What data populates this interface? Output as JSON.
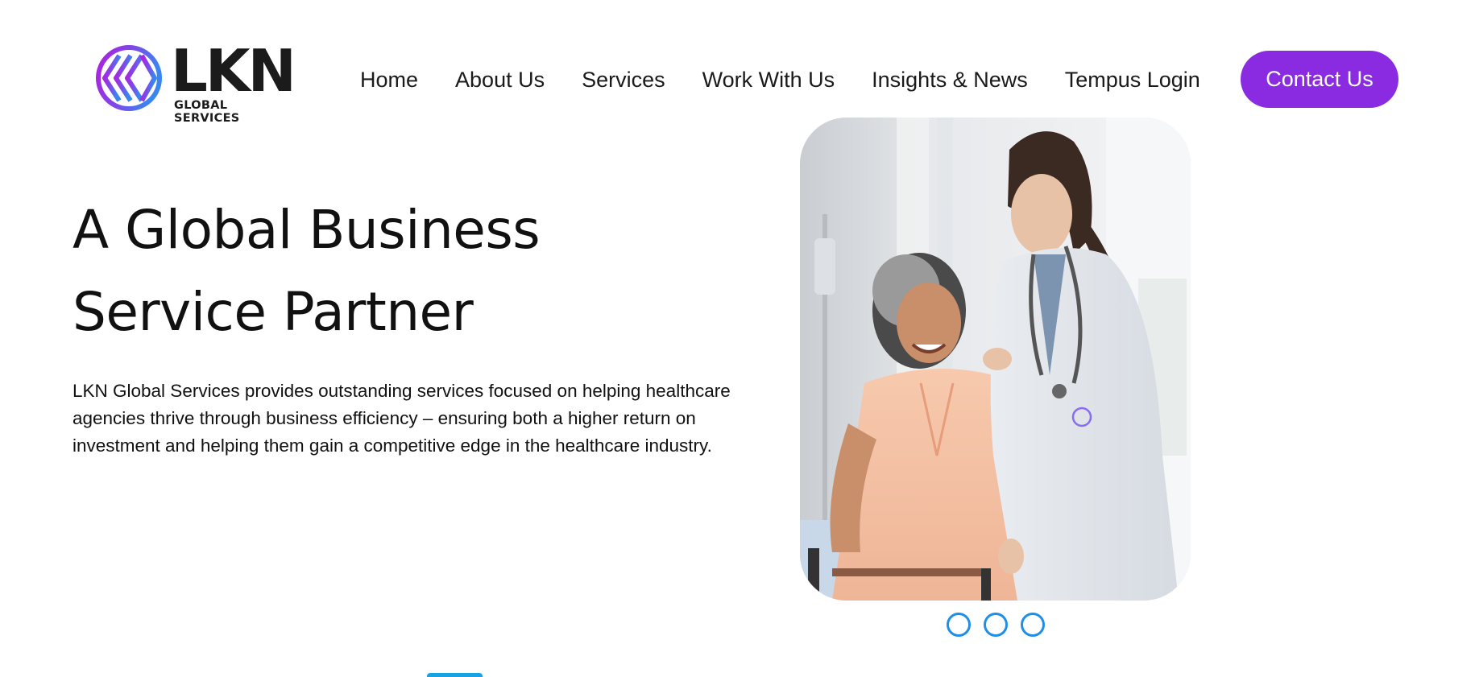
{
  "brand": {
    "name": "LKN",
    "subtitle": "GLOBAL SERVICES",
    "logo_icon": "lkn-chevron-logo-icon",
    "gradient_start": "#b01fe0",
    "gradient_end": "#3a86f0"
  },
  "nav": {
    "items": [
      {
        "label": "Home"
      },
      {
        "label": "About Us"
      },
      {
        "label": "Services"
      },
      {
        "label": "Work With Us"
      },
      {
        "label": "Insights & News"
      },
      {
        "label": "Tempus Login"
      }
    ],
    "cta_label": "Contact Us",
    "cta_color": "#8a2be2"
  },
  "hero": {
    "title": "A Global Business Service Partner",
    "description": "LKN Global Services provides outstanding services focused on helping healthcare agencies thrive through business efficiency – ensuring both a higher return on investment and helping them gain a competitive edge in the healthcare industry."
  },
  "carousel": {
    "image": "doctor-assisting-elderly-patient-photo",
    "slides_count": 3,
    "indicator_color": "#1e8ee6"
  },
  "colors": {
    "accent": "#8a2be2",
    "bottom_tab": "#16a2e3"
  }
}
